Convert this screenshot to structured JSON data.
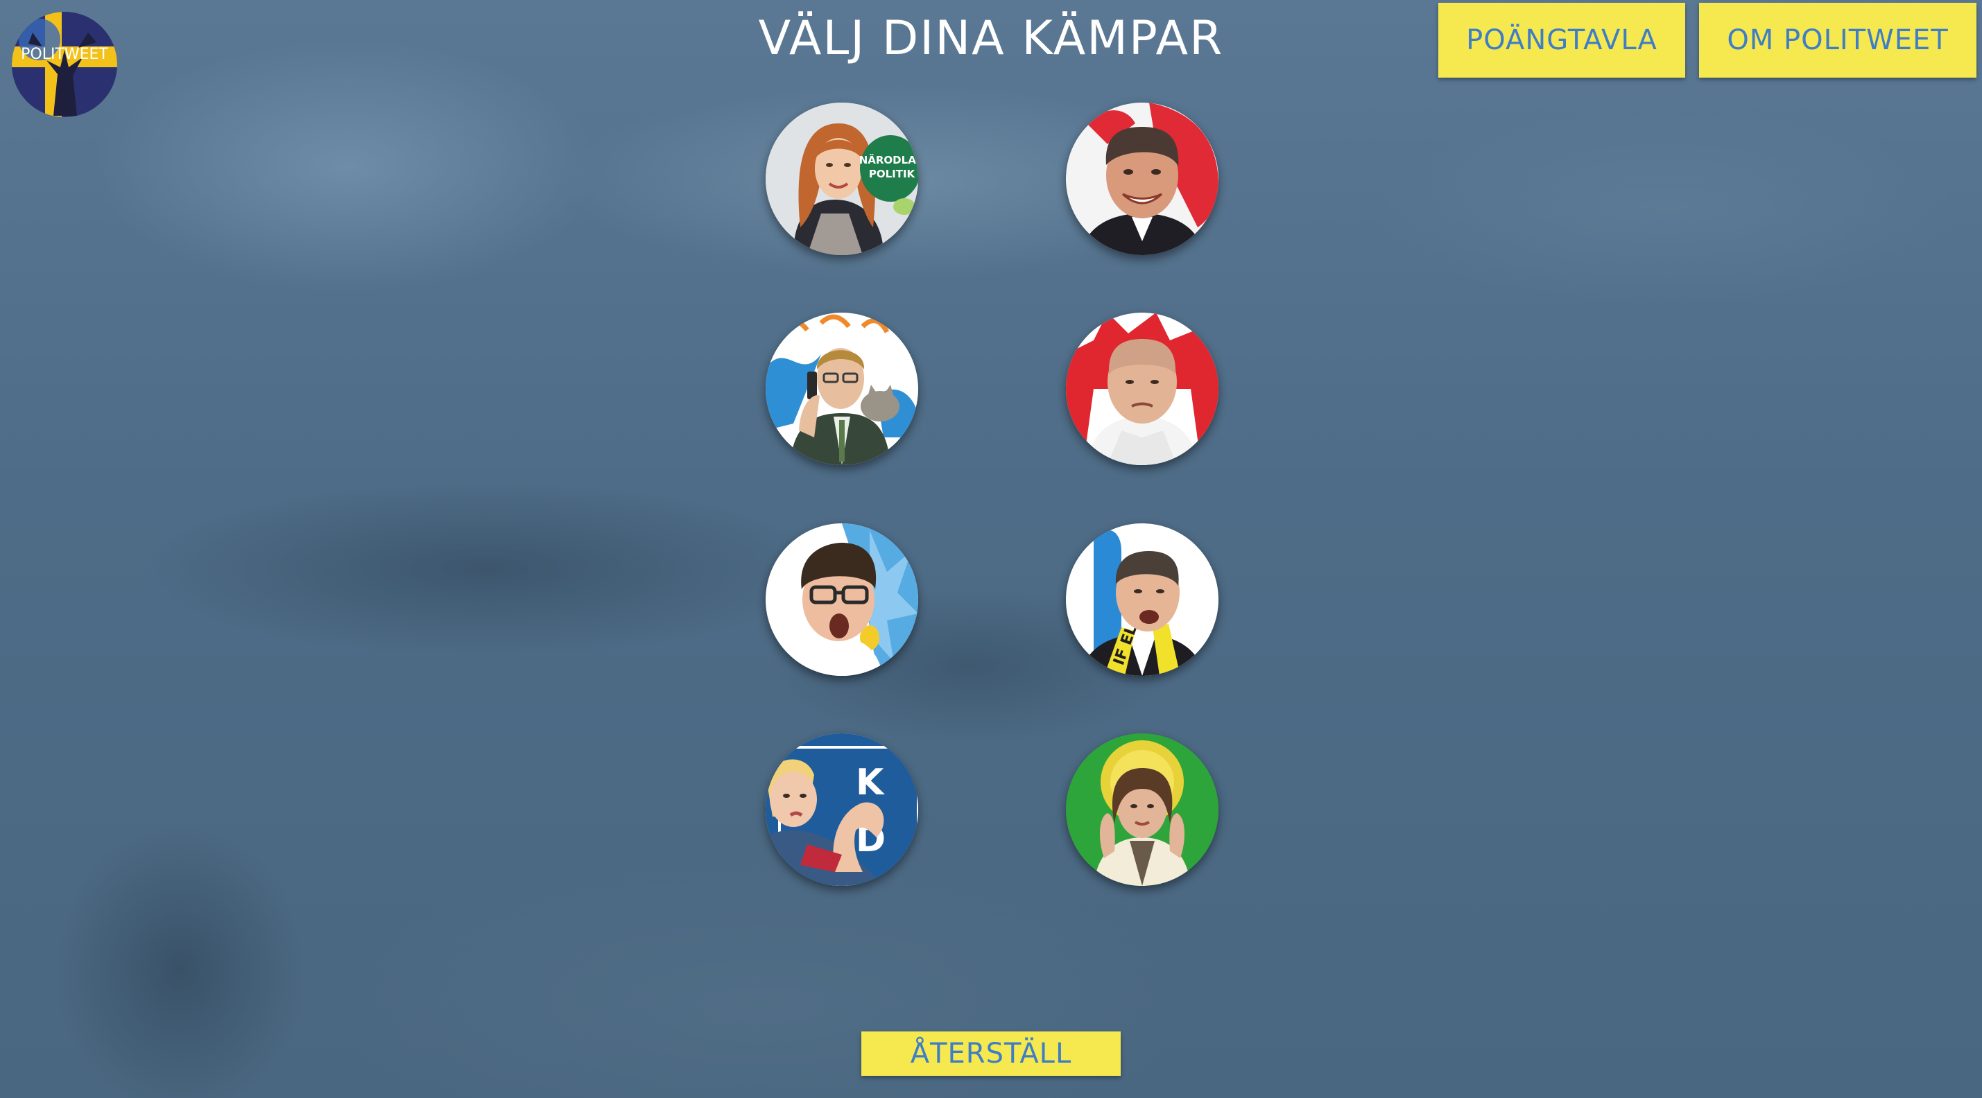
{
  "logo": {
    "text": "POLITWEET"
  },
  "header": {
    "title": "VÄLJ DINA KÄMPAR"
  },
  "nav": {
    "scoreboard_label": "POÄNGTAVLA",
    "about_label": "OM POLITWEET"
  },
  "footer": {
    "reset_label": "ÅTERSTÄLL"
  },
  "fighters": [
    {
      "bubble_line1": "NÄRODLAD",
      "bubble_line2": "POLITIK"
    },
    {},
    {},
    {},
    {},
    {
      "scarf_text": "IF EL"
    },
    {
      "sign_letter1": "K",
      "sign_letter2": "D"
    },
    {}
  ],
  "colors": {
    "button_bg": "#f5e94f",
    "button_text": "#3f7ec6",
    "title_text": "#ffffff"
  }
}
